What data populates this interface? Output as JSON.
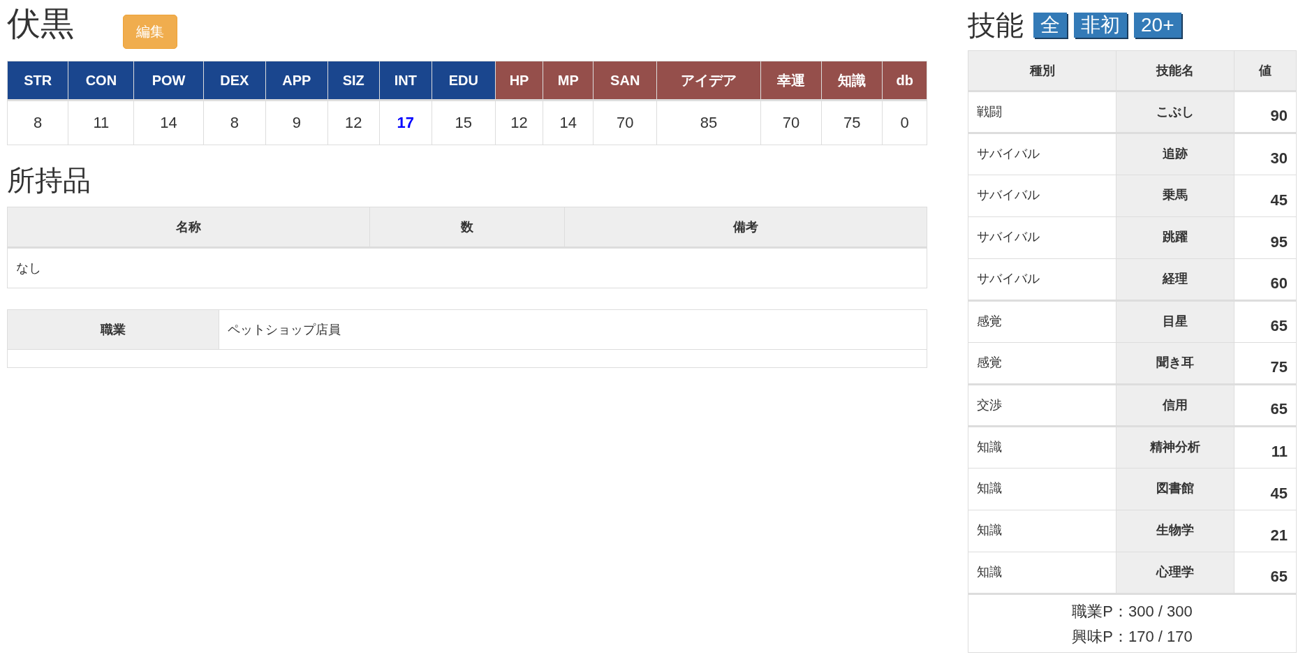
{
  "character": {
    "name": "伏黒",
    "edit_button": "編集"
  },
  "stats": [
    {
      "label": "STR",
      "value": "8",
      "kind": "base",
      "highlight": false
    },
    {
      "label": "CON",
      "value": "11",
      "kind": "base",
      "highlight": false
    },
    {
      "label": "POW",
      "value": "14",
      "kind": "base",
      "highlight": false
    },
    {
      "label": "DEX",
      "value": "8",
      "kind": "base",
      "highlight": false
    },
    {
      "label": "APP",
      "value": "9",
      "kind": "base",
      "highlight": false
    },
    {
      "label": "SIZ",
      "value": "12",
      "kind": "base",
      "highlight": false
    },
    {
      "label": "INT",
      "value": "17",
      "kind": "base",
      "highlight": true
    },
    {
      "label": "EDU",
      "value": "15",
      "kind": "base",
      "highlight": false
    },
    {
      "label": "HP",
      "value": "12",
      "kind": "derived",
      "highlight": false
    },
    {
      "label": "MP",
      "value": "14",
      "kind": "derived",
      "highlight": false
    },
    {
      "label": "SAN",
      "value": "70",
      "kind": "derived",
      "highlight": false
    },
    {
      "label": "アイデア",
      "value": "85",
      "kind": "derived",
      "highlight": false
    },
    {
      "label": "幸運",
      "value": "70",
      "kind": "derived",
      "highlight": false
    },
    {
      "label": "知識",
      "value": "75",
      "kind": "derived",
      "highlight": false
    },
    {
      "label": "db",
      "value": "0",
      "kind": "derived",
      "highlight": false
    }
  ],
  "inventory": {
    "title": "所持品",
    "columns": [
      "名称",
      "数",
      "備考"
    ],
    "empty_text": "なし"
  },
  "occupation": {
    "label": "職業",
    "value": "ペットショップ店員"
  },
  "skills": {
    "title": "技能",
    "filters": [
      "全",
      "非初",
      "20+"
    ],
    "columns": [
      "種別",
      "技能名",
      "値"
    ],
    "groups": [
      {
        "rows": [
          {
            "category": "戦闘",
            "name": "こぶし",
            "value": "90"
          }
        ]
      },
      {
        "rows": [
          {
            "category": "サバイバル",
            "name": "追跡",
            "value": "30"
          },
          {
            "category": "サバイバル",
            "name": "乗馬",
            "value": "45"
          },
          {
            "category": "サバイバル",
            "name": "跳躍",
            "value": "95"
          },
          {
            "category": "サバイバル",
            "name": "経理",
            "value": "60"
          }
        ]
      },
      {
        "rows": [
          {
            "category": "感覚",
            "name": "目星",
            "value": "65"
          },
          {
            "category": "感覚",
            "name": "聞き耳",
            "value": "75"
          }
        ]
      },
      {
        "rows": [
          {
            "category": "交渉",
            "name": "信用",
            "value": "65"
          }
        ]
      },
      {
        "rows": [
          {
            "category": "知識",
            "name": "精神分析",
            "value": "11"
          },
          {
            "category": "知識",
            "name": "図書館",
            "value": "45"
          },
          {
            "category": "知識",
            "name": "生物学",
            "value": "21"
          },
          {
            "category": "知識",
            "name": "心理学",
            "value": "65"
          }
        ]
      }
    ],
    "points": [
      "職業P：300 / 300",
      "興味P：170 / 170"
    ]
  }
}
